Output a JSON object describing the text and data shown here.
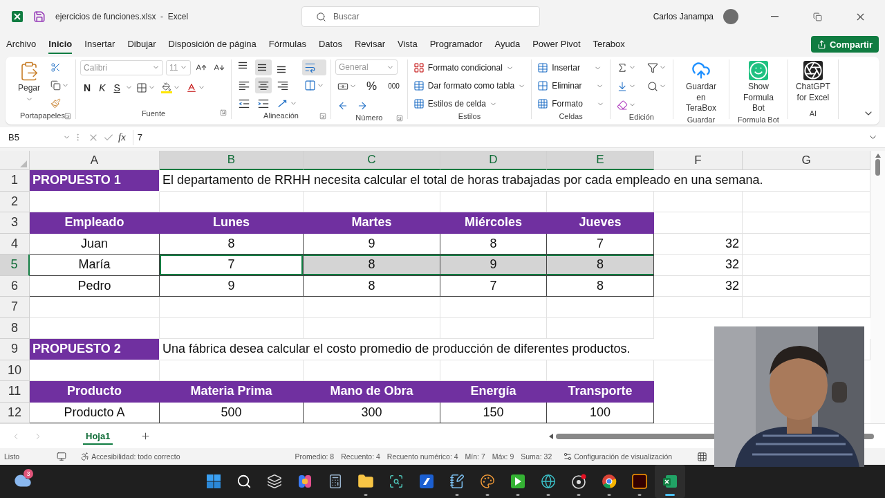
{
  "title_bar": {
    "file_title": "ejercicios de funciones.xlsx  -  Excel",
    "search_placeholder": "Buscar",
    "user_name": "Carlos Janampa"
  },
  "menu_tabs": [
    {
      "label": "Archivo",
      "selected": false
    },
    {
      "label": "Inicio",
      "selected": true
    },
    {
      "label": "Insertar",
      "selected": false
    },
    {
      "label": "Dibujar",
      "selected": false
    },
    {
      "label": "Disposición de página",
      "selected": false
    },
    {
      "label": "Fórmulas",
      "selected": false
    },
    {
      "label": "Datos",
      "selected": false
    },
    {
      "label": "Revisar",
      "selected": false
    },
    {
      "label": "Vista",
      "selected": false
    },
    {
      "label": "Programador",
      "selected": false
    },
    {
      "label": "Ayuda",
      "selected": false
    },
    {
      "label": "Power Pivot",
      "selected": false
    },
    {
      "label": "Terabox",
      "selected": false
    }
  ],
  "share_button": "Compartir",
  "ribbon": [
    {
      "kind": "clipboard",
      "label": "Portapapeles",
      "dialog_launcher": true,
      "paste": "Pegar"
    },
    {
      "kind": "font",
      "label": "Fuente",
      "dialog_launcher": true,
      "font": "Calibri",
      "size": "11",
      "bold": "N",
      "italic": "K",
      "underline": "S"
    },
    {
      "kind": "alignment",
      "label": "Alineación",
      "dialog_launcher": true,
      "buttons": [
        {
          "kind": "top",
          "selected": false
        },
        {
          "kind": "middle",
          "selected": true
        },
        {
          "kind": "bottom",
          "selected": false
        },
        {
          "kind": "wrap",
          "selected": true
        },
        {
          "kind": "left",
          "selected": false
        },
        {
          "kind": "center",
          "selected": true
        },
        {
          "kind": "right",
          "selected": false
        },
        {
          "kind": "merge",
          "selected": false
        },
        {
          "kind": "outdent",
          "selected": false
        },
        {
          "kind": "indent",
          "selected": false
        },
        {
          "kind": "orientation",
          "selected": false
        }
      ]
    },
    {
      "kind": "number",
      "label": "Número",
      "dialog_launcher": true,
      "format": "General",
      "percent": "%",
      "thousands": "000"
    },
    {
      "kind": "styles",
      "label": "Estilos",
      "dialog_launcher": false,
      "commands": [
        "Formato condicional",
        "Dar formato como tabla",
        "Estilos de celda"
      ]
    },
    {
      "kind": "cells",
      "label": "Celdas",
      "dialog_launcher": false,
      "commands": [
        "Insertar",
        "Eliminar",
        "Formato"
      ]
    },
    {
      "kind": "editing",
      "label": "Edición",
      "dialog_launcher": false
    },
    {
      "kind": "terabox",
      "label": "Guardar",
      "dialog_launcher": false,
      "button": "Guardar en TeraBox"
    },
    {
      "kind": "formulabot",
      "label": "Formula Bot",
      "dialog_launcher": false,
      "button": "Show Formula Bot"
    },
    {
      "kind": "chatgpt",
      "label": "AI",
      "dialog_launcher": false,
      "button": "ChatGPT for Excel"
    }
  ],
  "formula_bar": {
    "name_box": "B5",
    "function_label": "fx",
    "value": "7"
  },
  "sheet": {
    "columns": [
      {
        "label": "A",
        "selected": false
      },
      {
        "label": "B",
        "selected": true
      },
      {
        "label": "C",
        "selected": true
      },
      {
        "label": "D",
        "selected": true
      },
      {
        "label": "E",
        "selected": true
      },
      {
        "label": "F",
        "selected": false
      },
      {
        "label": "G",
        "selected": false
      }
    ],
    "rows": [
      {
        "label": "1",
        "selected": false,
        "cells": [
          {
            "kind": "title",
            "text": "PROPUESTO 1",
            "selected": false
          },
          {
            "kind": "note",
            "text": "El departamento de RRHH necesita calcular el total de horas trabajadas por cada empleado en una semana.",
            "selected": false
          }
        ]
      },
      {
        "label": "2",
        "selected": false
      },
      {
        "label": "3",
        "selected": false,
        "cells": [
          {
            "kind": "header",
            "text": "Empleado",
            "selected": false
          },
          {
            "kind": "header",
            "text": "Lunes",
            "selected": false
          },
          {
            "kind": "header",
            "text": "Martes",
            "selected": false
          },
          {
            "kind": "header",
            "text": "Miércoles",
            "selected": false
          },
          {
            "kind": "header",
            "text": "Jueves",
            "selected": false
          }
        ]
      },
      {
        "label": "4",
        "selected": false,
        "cells": [
          {
            "kind": "data",
            "text": "Juan",
            "selected": false
          },
          {
            "kind": "data",
            "text": "8",
            "selected": false
          },
          {
            "kind": "data",
            "text": "9",
            "selected": false
          },
          {
            "kind": "data",
            "text": "8",
            "selected": false
          },
          {
            "kind": "data",
            "text": "7",
            "selected": false
          },
          {
            "kind": "number",
            "text": "32",
            "selected": false
          }
        ]
      },
      {
        "label": "5",
        "selected": true,
        "cells": [
          {
            "kind": "data",
            "text": "María",
            "selected": false,
            "active": false
          },
          {
            "kind": "data",
            "text": "7",
            "selected": true,
            "active": true
          },
          {
            "kind": "data",
            "text": "8",
            "selected": true,
            "active": false
          },
          {
            "kind": "data",
            "text": "9",
            "selected": true,
            "active": false
          },
          {
            "kind": "data",
            "text": "8",
            "selected": true,
            "active": false
          },
          {
            "kind": "number",
            "text": "32",
            "selected": false,
            "active": false
          }
        ]
      },
      {
        "label": "6",
        "selected": false,
        "cells": [
          {
            "kind": "data",
            "text": "Pedro",
            "selected": false
          },
          {
            "kind": "data",
            "text": "9",
            "selected": false
          },
          {
            "kind": "data",
            "text": "8",
            "selected": false
          },
          {
            "kind": "data",
            "text": "7",
            "selected": false
          },
          {
            "kind": "data",
            "text": "8",
            "selected": false
          },
          {
            "kind": "number",
            "text": "32",
            "selected": false
          }
        ]
      },
      {
        "label": "7",
        "selected": false
      },
      {
        "label": "8",
        "selected": false
      },
      {
        "label": "9",
        "selected": false,
        "cells": [
          {
            "kind": "title",
            "text": "PROPUESTO 2",
            "selected": false
          },
          {
            "kind": "note",
            "text": "Una fábrica desea calcular el costo promedio de producción de diferentes productos.",
            "selected": false
          }
        ]
      },
      {
        "label": "10",
        "selected": false
      },
      {
        "label": "11",
        "selected": false,
        "cells": [
          {
            "kind": "header",
            "text": "Producto",
            "selected": false
          },
          {
            "kind": "header",
            "text": "Materia Prima",
            "selected": false
          },
          {
            "kind": "header",
            "text": "Mano de Obra",
            "selected": false
          },
          {
            "kind": "header",
            "text": "Energía",
            "selected": false
          },
          {
            "kind": "header",
            "text": "Transporte",
            "selected": false
          }
        ]
      },
      {
        "label": "12",
        "selected": false,
        "cells": [
          {
            "kind": "data",
            "text": "Producto A",
            "selected": false
          },
          {
            "kind": "data",
            "text": "500",
            "selected": false
          },
          {
            "kind": "data",
            "text": "300",
            "selected": false
          },
          {
            "kind": "data",
            "text": "150",
            "selected": false
          },
          {
            "kind": "data",
            "text": "100",
            "selected": false
          }
        ]
      }
    ]
  },
  "sheet_tabs": [
    {
      "label": "Hoja1",
      "selected": true
    }
  ],
  "status_bar": {
    "mode": "Listo",
    "accessibility": "Accesibilidad: todo correcto",
    "stats": [
      "Promedio: 8",
      "Recuento: 4",
      "Recuento numérico: 4",
      "Mín: 7",
      "Máx: 9",
      "Suma: 32"
    ],
    "view_settings": "Configuración de visualización"
  },
  "taskbar": {
    "notification_badge": "3",
    "apps": [
      {
        "kind": "start",
        "running": false,
        "selected": false
      },
      {
        "kind": "search",
        "running": false,
        "selected": false
      },
      {
        "kind": "taskview",
        "running": false,
        "selected": false
      },
      {
        "kind": "copilot",
        "running": false,
        "selected": false
      },
      {
        "kind": "calculator",
        "running": false,
        "selected": false
      },
      {
        "kind": "explorer",
        "running": true,
        "selected": false
      },
      {
        "kind": "snip",
        "running": false,
        "selected": false
      },
      {
        "kind": "bluetile",
        "running": false,
        "selected": false
      },
      {
        "kind": "notepad",
        "running": true,
        "selected": false
      },
      {
        "kind": "paint",
        "running": true,
        "selected": false
      },
      {
        "kind": "greentile",
        "running": true,
        "selected": false
      },
      {
        "kind": "edge",
        "running": true,
        "selected": false
      },
      {
        "kind": "recorder",
        "running": true,
        "selected": false
      },
      {
        "kind": "chrome",
        "running": true,
        "selected": false
      },
      {
        "kind": "design",
        "running": true,
        "selected": false
      },
      {
        "kind": "excel",
        "running": true,
        "selected": true
      }
    ]
  }
}
